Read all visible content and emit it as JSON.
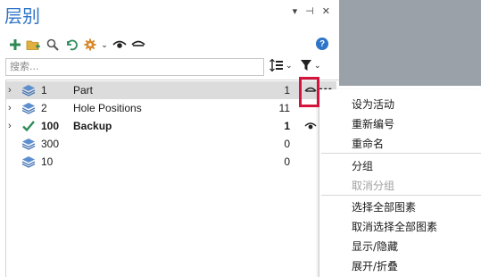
{
  "panel": {
    "title": "层别",
    "window_buttons": {
      "dropdown": "▾",
      "pin": "⊣",
      "close": "✕"
    },
    "search_placeholder": "搜索...",
    "help": "?"
  },
  "toolbar": {
    "icons": [
      "add-layer-icon",
      "add-folder-icon",
      "search-icon",
      "undo-icon",
      "settings-icon",
      "eye-icon",
      "eye-closed-icon"
    ]
  },
  "tree": {
    "rows": [
      {
        "num": "1",
        "name": "Part",
        "count": "1",
        "icon": "layers",
        "bold": false,
        "selected": true,
        "expander": "›"
      },
      {
        "num": "2",
        "name": "Hole Positions",
        "count": "11",
        "icon": "layers",
        "bold": false,
        "selected": false,
        "expander": "›"
      },
      {
        "num": "100",
        "name": "Backup",
        "count": "1",
        "icon": "check",
        "bold": true,
        "selected": false,
        "expander": "›"
      },
      {
        "num": "300",
        "name": "",
        "count": "0",
        "icon": "layers",
        "bold": false,
        "selected": false,
        "expander": ""
      },
      {
        "num": "10",
        "name": "",
        "count": "0",
        "icon": "layers",
        "bold": false,
        "selected": false,
        "expander": ""
      }
    ],
    "more": "•••"
  },
  "context_menu": {
    "items": [
      {
        "label": "设为活动",
        "disabled": false
      },
      {
        "label": "重新编号",
        "disabled": false
      },
      {
        "label": "重命名",
        "disabled": false
      },
      {
        "label": "分组",
        "disabled": false
      },
      {
        "label": "取消分组",
        "disabled": true
      },
      {
        "label": "选择全部图素",
        "disabled": false
      },
      {
        "label": "取消选择全部图素",
        "disabled": false
      },
      {
        "label": "显示/隐藏",
        "disabled": false
      },
      {
        "label": "展开/折叠",
        "disabled": false
      }
    ]
  },
  "colors": {
    "accent": "#2e74c8",
    "highlight": "#d4143c",
    "selected_row": "#dcdcdc",
    "check": "#2e8b57"
  }
}
